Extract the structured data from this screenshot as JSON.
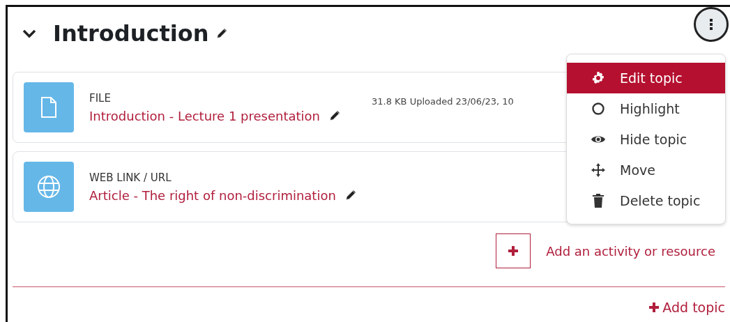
{
  "section": {
    "title": "Introduction",
    "expanded": true
  },
  "activities": [
    {
      "kind": "file",
      "type_label": "FILE",
      "name": "Introduction - Lecture 1 presentation",
      "meta": "31.8 KB Uploaded 23/06/23, 10"
    },
    {
      "kind": "url",
      "type_label": "WEB LINK / URL",
      "name": "Article - The right of non-discrimination"
    }
  ],
  "menu": {
    "items": [
      {
        "kind": "edit",
        "label": "Edit topic",
        "selected": true
      },
      {
        "kind": "highlight",
        "label": "Highlight",
        "selected": false
      },
      {
        "kind": "hide",
        "label": "Hide topic",
        "selected": false
      },
      {
        "kind": "move",
        "label": "Move",
        "selected": false
      },
      {
        "kind": "delete",
        "label": "Delete topic",
        "selected": false
      }
    ]
  },
  "add_activity": {
    "label": "Add an activity or resource"
  },
  "add_topic": {
    "label": "Add topic"
  }
}
